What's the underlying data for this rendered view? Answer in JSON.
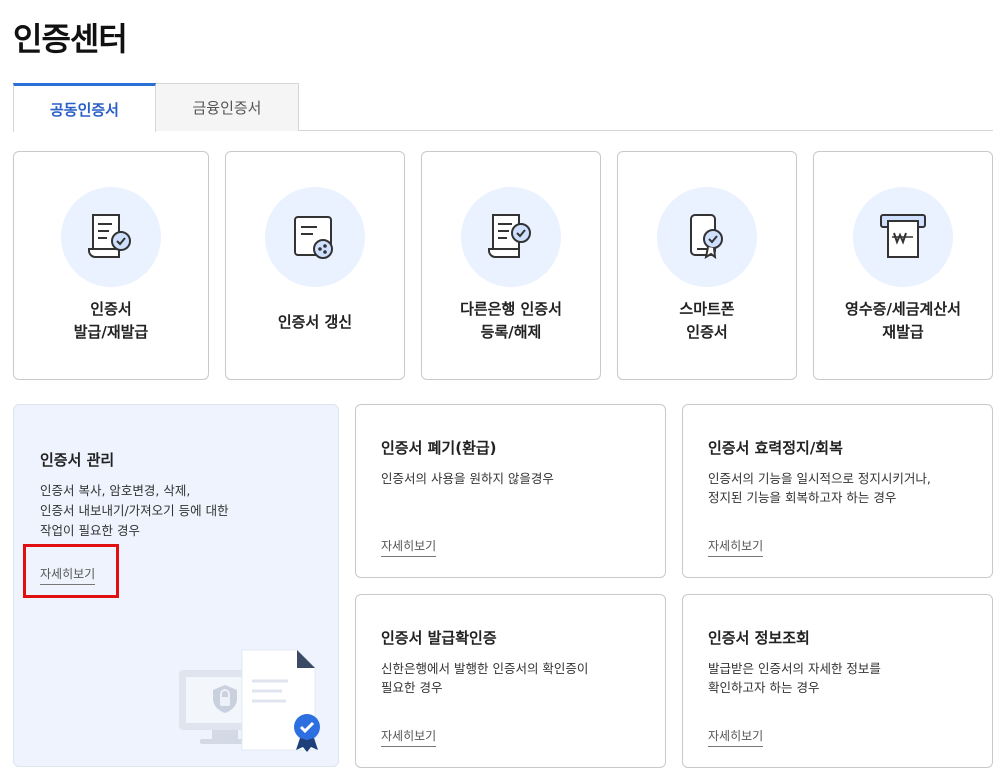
{
  "page": {
    "title": "인증센터"
  },
  "tabs": [
    {
      "label": "공동인증서",
      "active": true
    },
    {
      "label": "금융인증서",
      "active": false
    }
  ],
  "services": [
    {
      "label": "인증서\n발급/재발급",
      "icon": "certificate-issue-icon"
    },
    {
      "label": "인증서 갱신",
      "icon": "certificate-renew-icon"
    },
    {
      "label": "다른은행 인증서\n등록/해제",
      "icon": "certificate-register-icon"
    },
    {
      "label": "스마트폰\n인증서",
      "icon": "smartphone-certificate-icon"
    },
    {
      "label": "영수증/세금계산서\n재발급",
      "icon": "receipt-icon"
    }
  ],
  "management": {
    "title": "인증서 관리",
    "description": "인증서 복사, 암호변경, 삭제,\n인증서 내보내기/가져오기 등에 대한\n작업이 필요한 경우",
    "link": "자세히보기"
  },
  "info_cards": [
    {
      "title": "인증서 폐기(환급)",
      "description": "인증서의 사용을 원하지 않을경우",
      "link": "자세히보기"
    },
    {
      "title": "인증서 효력정지/회복",
      "description": "인증서의 기능을 일시적으로 정지시키거나,\n정지된 기능을 회복하고자 하는 경우",
      "link": "자세히보기"
    },
    {
      "title": "인증서 발급확인증",
      "description": "신한은행에서 발행한 인증서의 확인증이\n필요한 경우",
      "link": "자세히보기"
    },
    {
      "title": "인증서 정보조회",
      "description": "발급받은 인증서의 자세한 정보를\n확인하고자 하는 경우",
      "link": "자세히보기"
    }
  ],
  "colors": {
    "accent": "#2a6fd6",
    "icon_bg": "#eaf1ff",
    "panel_bg": "#eef3fd",
    "highlight": "#e01010"
  }
}
